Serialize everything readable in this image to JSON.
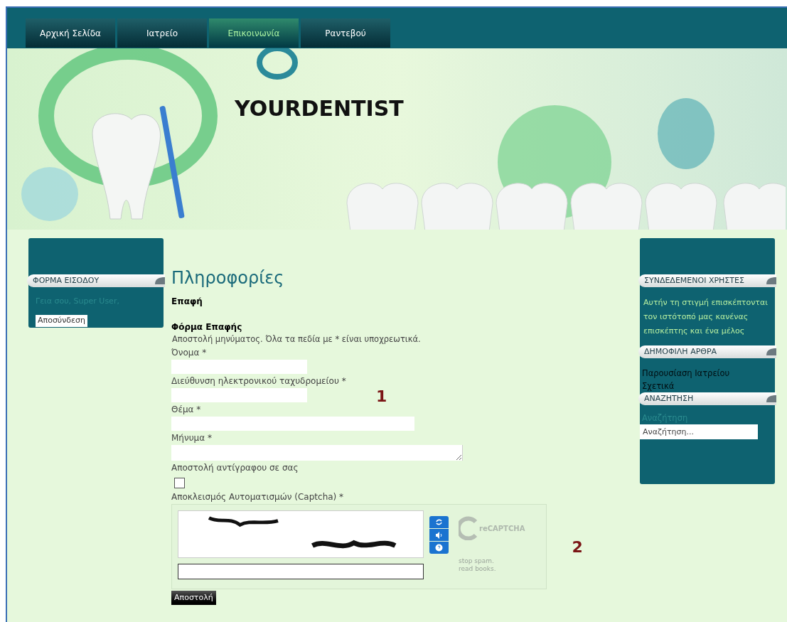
{
  "nav": [
    {
      "label": "Αρχική Σελίδα",
      "selected": false
    },
    {
      "label": "Ιατρείο",
      "selected": false
    },
    {
      "label": "Επικοινωνία",
      "selected": true
    },
    {
      "label": "Ραντεβού",
      "selected": false
    }
  ],
  "banner": {
    "title": "YOURDENTIST"
  },
  "left_sidebar": {
    "module_title": "ΦΟΡΜΑ ΕΙΣΟΔΟΥ",
    "greeting": "Γεια σου, Super User,",
    "logout_button": "Αποσύνδεση"
  },
  "content": {
    "heading": "Πληροφορίες",
    "subheading": "Επαφή",
    "form_title": "Φόρμα Επαφής",
    "intro": "Αποστολή μηνύματος. Όλα τα πεδία με * είναι υποχρεωτικά.",
    "fields": [
      {
        "kind": "short",
        "label": "Όνομα *"
      },
      {
        "kind": "short",
        "label": "Διεύθυνση ηλεκτρονικού ταχυδρομείου *"
      },
      {
        "kind": "medium",
        "label": "Θέμα *"
      },
      {
        "kind": "textarea",
        "label": "Μήνυμα *"
      },
      {
        "kind": "checkbox",
        "label": "Αποστολή αντίγραφου σε σας",
        "checked": false
      }
    ],
    "captcha": {
      "label": "Αποκλεισμός Αυτοματισμών (Captcha) *",
      "logo_text": "reCAPTCHA",
      "tagline": [
        "stop spam.",
        "read books."
      ]
    },
    "submit": "Αποστολή",
    "annotations": [
      "1",
      "2"
    ]
  },
  "right_sidebar": [
    {
      "kind": "text",
      "title": "ΣΥΝΔΕΔΕΜΕΝΟΙ ΧΡΗΣΤΕΣ",
      "text": "Αυτήν τη στιγμή επισκέπτονται τον ιστότοπό μας κανένας επισκέπτης και ένα μέλος"
    },
    {
      "kind": "links",
      "title": "ΔΗΜΟΦΙΛΗ ΑΡΘΡΑ",
      "links": [
        "Παρουσίαση Ιατρείου",
        "Σχετικά"
      ]
    },
    {
      "kind": "search",
      "title": "ΑΝΑΖΗΤΗΣΗ",
      "label": "Αναζήτηση",
      "placeholder": "Αναζήτηση..."
    }
  ]
}
